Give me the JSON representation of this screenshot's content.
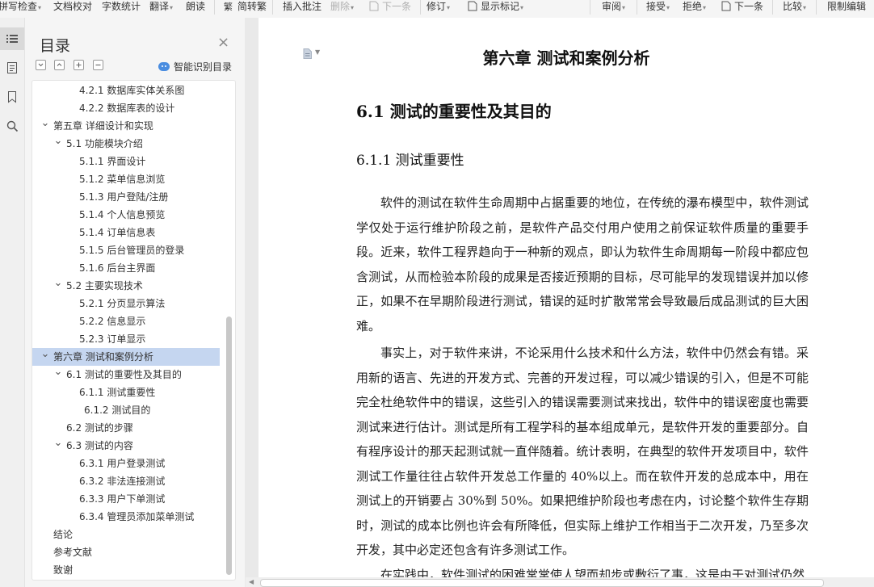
{
  "toolbar": {
    "items": [
      {
        "label": "拼写检查",
        "caret": true
      },
      {
        "label": "文档校对"
      },
      {
        "label": "字数统计"
      },
      {
        "label": "翻译",
        "caret": true
      },
      {
        "label": "朗读"
      },
      {
        "label": "简转繁"
      },
      {
        "label": "插入批注"
      },
      {
        "label": "删除",
        "caret": true,
        "disabled": true
      },
      {
        "label": "下一条",
        "disabled": true
      },
      {
        "label": "修订",
        "caret": true
      },
      {
        "label": "显示标记",
        "caret": true
      },
      {
        "label": "审阅",
        "caret": true
      },
      {
        "label": "接受",
        "caret": true
      },
      {
        "label": "拒绝",
        "caret": true
      },
      {
        "label": "下一条"
      },
      {
        "label": "比较",
        "caret": true
      },
      {
        "label": "限制编辑"
      }
    ]
  },
  "toc": {
    "title": "目录",
    "close": "×",
    "smart_label": "智能识别目录",
    "items": [
      {
        "text": "4.2.1 数据库实体关系图",
        "level": 3
      },
      {
        "text": "4.2.2 数据库表的设计",
        "level": 3
      },
      {
        "text": "第五章  详细设计和实现",
        "level": 1,
        "expanded": true
      },
      {
        "text": "5.1 功能模块介绍",
        "level": 2,
        "expanded": true
      },
      {
        "text": "5.1.1 界面设计",
        "level": 3
      },
      {
        "text": "5.1.2  菜单信息浏览",
        "level": 3
      },
      {
        "text": "5.1.3  用户登陆/注册",
        "level": 3
      },
      {
        "text": "5.1.4  个人信息预览",
        "level": 3
      },
      {
        "text": "5.1.4  订单信息表",
        "level": 3
      },
      {
        "text": "5.1.5  后台管理员的登录",
        "level": 3
      },
      {
        "text": "5.1.6  后台主界面",
        "level": 3
      },
      {
        "text": "5.2 主要实现技术",
        "level": 2,
        "expanded": true
      },
      {
        "text": "5.2.1 分页显示算法",
        "level": 3
      },
      {
        "text": "5.2.2  信息显示",
        "level": 3
      },
      {
        "text": "5.2.3  订单显示",
        "level": 3
      },
      {
        "text": "第六章  测试和案例分析",
        "level": 1,
        "expanded": true,
        "selected": true
      },
      {
        "text": "6.1 测试的重要性及其目的",
        "level": 2,
        "expanded": true
      },
      {
        "text": "6.1.1 测试重要性",
        "level": 3
      },
      {
        "text": "6.1.2 测试目的",
        "level": 4
      },
      {
        "text": "6.2 测试的步骤",
        "level": 2
      },
      {
        "text": "6.3 测试的内容",
        "level": 2,
        "expanded": true
      },
      {
        "text": "6.3.1 用户登录测试",
        "level": 3
      },
      {
        "text": "6.3.2 非法连接测试",
        "level": 3
      },
      {
        "text": "6.3.3  用户下单测试",
        "level": 3
      },
      {
        "text": "6.3.4  管理员添加菜单测试",
        "level": 3
      },
      {
        "text": "结论",
        "level": 1
      },
      {
        "text": "参考文献",
        "level": 1
      },
      {
        "text": "致谢",
        "level": 1
      }
    ]
  },
  "document": {
    "chapter_title": "第六章  测试和案例分析",
    "section_title": "6.1 测试的重要性及其目的",
    "subsection_title": "6.1.1 测试重要性",
    "paragraphs": [
      "软件的测试在软件生命周期中占据重要的地位，在传统的瀑布模型中，软件测试学仅处于运行维护阶段之前，是软件产品交付用户使用之前保证软件质量的重要手段。近来，软件工程界趋向于一种新的观点，即认为软件生命周期每一阶段中都应包含测试，从而检验本阶段的成果是否接近预期的目标，尽可能早的发现错误并加以修正，如果不在早期阶段进行测试，错误的延时扩散常常会导致最后成品测试的巨大困难。",
      "事实上，对于软件来讲，不论采用什么技术和什么方法，软件中仍然会有错。采用新的语言、先进的开发方式、完善的开发过程，可以减少错误的引入，但是不可能完全杜绝软件中的错误，这些引入的错误需要测试来找出，软件中的错误密度也需要测试来进行估计。测试是所有工程学科的基本组成单元，是软件开发的重要部分。自有程序设计的那天起测试就一直伴随着。统计表明，在典型的软件开发项目中，软件测试工作量往往占软件开发总工作量的 40%以上。而在软件开发的总成本中，用在测试上的开销要占 30%到 50%。如果把维护阶段也考虑在内，讨论整个软件生存期时，测试的成本比例也许会有所降低，但实际上维护工作相当于二次开发，乃至多次开发，其中必定还包含有许多测试工作。",
      "在实践中，软件测试的困难常常使人望而却步或敷衍了事，这是由于对测试仍然"
    ]
  }
}
